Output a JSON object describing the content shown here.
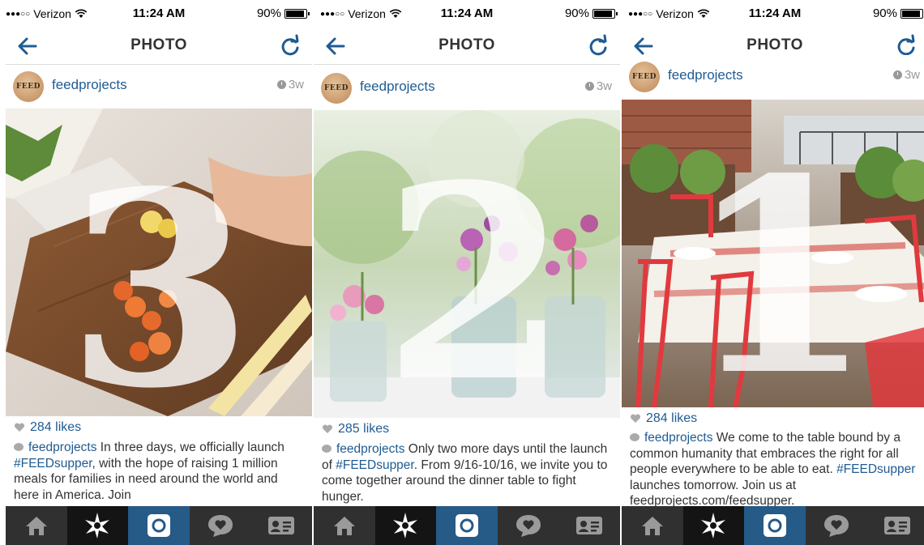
{
  "status": {
    "carrier": "Verizon",
    "time": "11:24 AM",
    "battery": "90%",
    "battery_level": 0.9
  },
  "nav": {
    "title": "PHOTO"
  },
  "colors": {
    "link": "#1f5b93",
    "active_tab": "#265a87",
    "tab_bar": "#303030"
  },
  "posts": [
    {
      "username": "feedprojects",
      "avatar_text": "FEED",
      "time": "3w",
      "likes": "284 likes",
      "caption": {
        "user": "feedprojects",
        "pre": " In three days, we officially launch ",
        "hashtag": "#FEEDsupper",
        "post": ", with the hope of raising 1 million meals for families in need around the world and here in America. Join"
      },
      "photo_number": "3"
    },
    {
      "username": "feedprojects",
      "avatar_text": "FEED",
      "time": "3w",
      "likes": "285 likes",
      "caption": {
        "user": "feedprojects",
        "pre": " Only two more days until the launch of ",
        "hashtag": "#FEEDsupper",
        "post": ". From 9/16-10/16, we invite you to come together around the dinner table to fight hunger."
      },
      "photo_number": "2"
    },
    {
      "username": "feedprojects",
      "avatar_text": "FEED",
      "time": "3w",
      "likes": "284 likes",
      "caption": {
        "user": "feedprojects",
        "pre": " We come to the table bound by a common humanity that embraces the right for all people everywhere to be able to eat. ",
        "hashtag": "#FEEDsupper",
        "post": " launches tomorrow. Join us at feedprojects.com/feedsupper."
      },
      "photo_number": "1"
    }
  ],
  "tabs": [
    {
      "name": "home-icon"
    },
    {
      "name": "explore-star-icon"
    },
    {
      "name": "camera-icon"
    },
    {
      "name": "activity-heart-bubble-icon"
    },
    {
      "name": "profile-card-icon"
    }
  ]
}
